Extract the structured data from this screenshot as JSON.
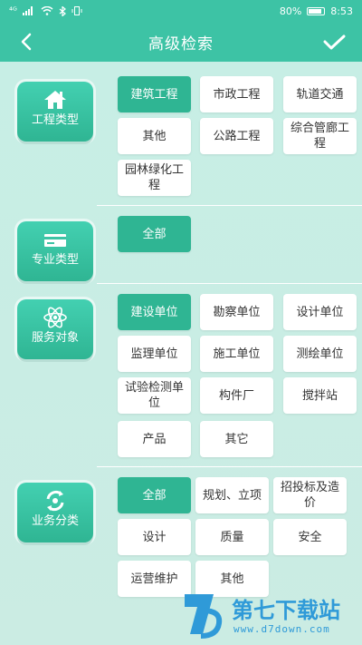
{
  "status_bar": {
    "signal": "⁴ᴳ",
    "battery_percent": "80%",
    "time": "8:53"
  },
  "header": {
    "title": "高级检索"
  },
  "sections": [
    {
      "category": "工程类型",
      "icon": "house-icon",
      "options": [
        "建筑工程",
        "市政工程",
        "轨道交通",
        "其他",
        "公路工程",
        "综合管廊工程",
        "园林绿化工程"
      ],
      "selected": "建筑工程"
    },
    {
      "category": "专业类型",
      "icon": "card-icon",
      "options": [
        "全部"
      ],
      "selected": "全部"
    },
    {
      "category": "服务对象",
      "icon": "atom-icon",
      "options": [
        "建设单位",
        "勘察单位",
        "设计单位",
        "监理单位",
        "施工单位",
        "测绘单位",
        "试验检测单位",
        "构件厂",
        "搅拌站",
        "产品",
        "其它"
      ],
      "selected": "建设单位"
    },
    {
      "category": "业务分类",
      "icon": "cycle-icon",
      "options": [
        "全部",
        "规划、立项",
        "招投标及造价",
        "设计",
        "质量",
        "安全",
        "运营维护",
        "其他"
      ],
      "selected": "全部"
    }
  ],
  "watermark": {
    "brand": "第七下载站",
    "url": "www.d7down.com"
  },
  "colors": {
    "accent": "#3dc3a5",
    "selected": "#2fb593",
    "background": "#c9ebe3"
  }
}
